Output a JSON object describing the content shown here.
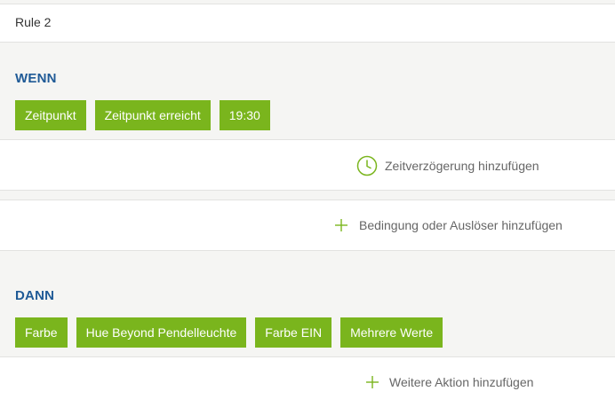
{
  "rule": {
    "name": "Rule 2"
  },
  "when": {
    "title": "WENN",
    "chips": [
      "Zeitpunkt",
      "Zeitpunkt erreicht",
      "19:30"
    ]
  },
  "delay_action": {
    "label": "Zeitverzögerung hinzufügen",
    "icon": "clock-icon"
  },
  "condition_action": {
    "label": "Bedingung oder Auslöser hinzufügen",
    "icon": "plus-icon"
  },
  "then": {
    "title": "DANN",
    "chips": [
      "Farbe",
      "Hue Beyond Pendelleuchte",
      "Farbe EIN",
      "Mehrere Werte"
    ]
  },
  "more_action": {
    "label": "Weitere Aktion hinzufügen",
    "icon": "plus-icon"
  },
  "colors": {
    "accent": "#7ab51d",
    "heading": "#1f5a96",
    "background": "#f5f5f3"
  }
}
